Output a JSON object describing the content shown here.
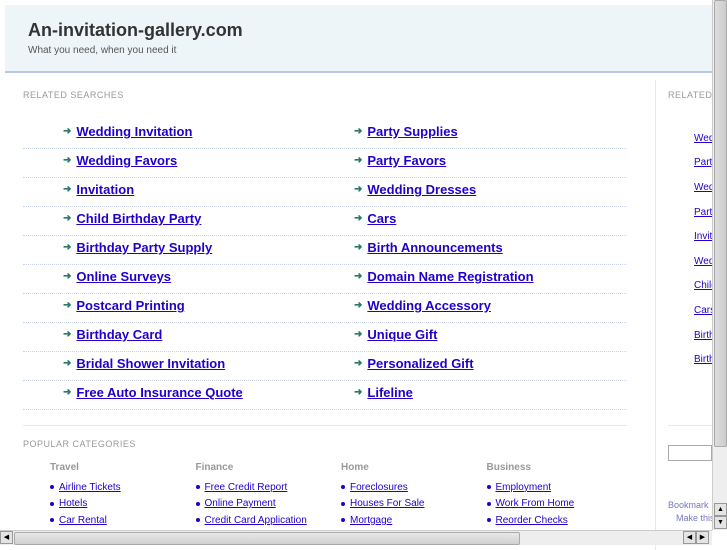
{
  "header": {
    "title": "An-invitation-gallery.com",
    "tagline": "What you need, when you need it"
  },
  "related": {
    "label": "RELATED SEARCHES",
    "left": [
      "Wedding Invitation",
      "Wedding Favors",
      "Invitation",
      "Child Birthday Party",
      "Birthday Party Supply",
      "Online Surveys",
      "Postcard Printing",
      "Birthday Card",
      "Bridal Shower Invitation",
      "Free Auto Insurance Quote"
    ],
    "right": [
      "Party Supplies",
      "Party Favors",
      "Wedding Dresses",
      "Cars",
      "Birth Announcements",
      "Domain Name Registration",
      "Wedding Accessory",
      "Unique Gift",
      "Personalized Gift",
      "Lifeline"
    ]
  },
  "popular": {
    "label": "POPULAR CATEGORIES",
    "categories": [
      {
        "title": "Travel",
        "links": [
          "Airline Tickets",
          "Hotels",
          "Car Rental"
        ]
      },
      {
        "title": "Finance",
        "links": [
          "Free Credit Report",
          "Online Payment",
          "Credit Card Application"
        ]
      },
      {
        "title": "Home",
        "links": [
          "Foreclosures",
          "Houses For Sale",
          "Mortgage"
        ]
      },
      {
        "title": "Business",
        "links": [
          "Employment",
          "Work From Home",
          "Reorder Checks"
        ]
      }
    ]
  },
  "sidebar": {
    "label": "RELATED",
    "links": [
      "Wedding Invitation",
      "Party Supplies",
      "Wedding Favors",
      "Party Favors",
      "Invitation",
      "Wedding Dresses",
      "Child Birthday Party",
      "Cars",
      "Birthday Party Supply",
      "Birth Announcements"
    ],
    "bookmark": "Bookmark",
    "make": "Make this"
  }
}
